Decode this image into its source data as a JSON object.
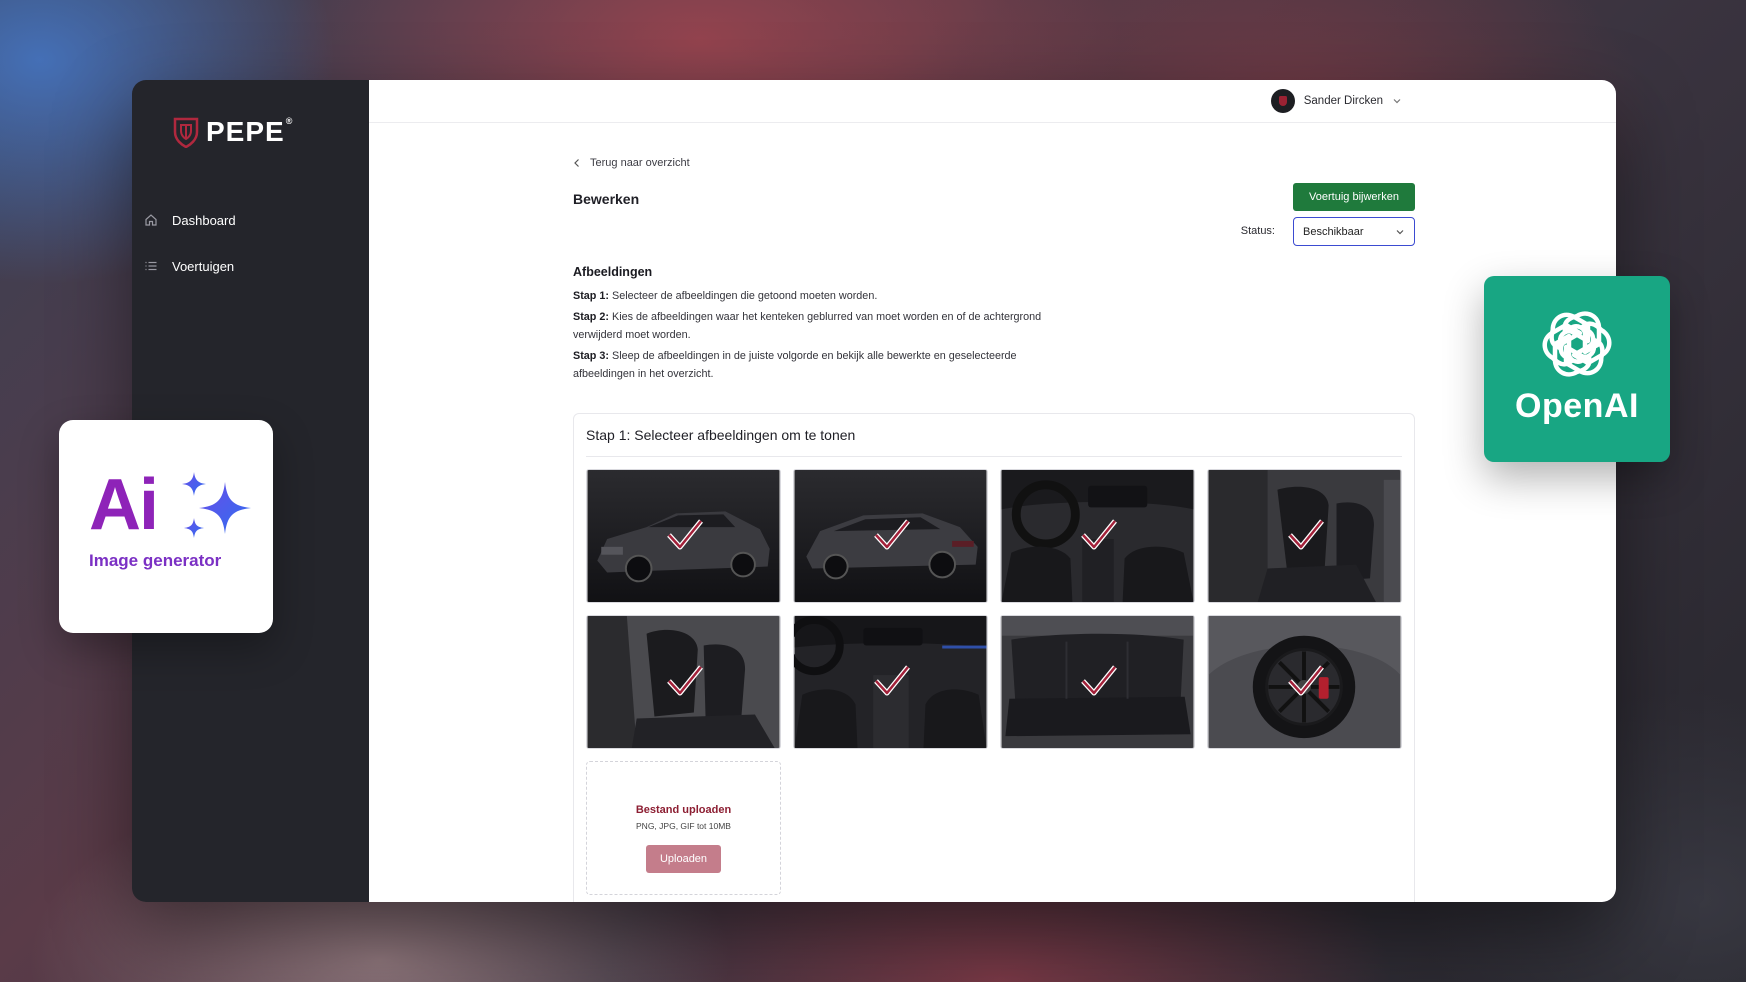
{
  "brand": {
    "name": "PEPE",
    "registered": "®",
    "accent": "#b0283e"
  },
  "sidebar": {
    "items": [
      {
        "label": "Dashboard",
        "icon": "home-icon"
      },
      {
        "label": "Voertuigen",
        "icon": "list-icon"
      }
    ]
  },
  "topbar": {
    "user_name": "Sander Dircken"
  },
  "page": {
    "back_label": "Terug naar overzicht",
    "title": "Bewerken",
    "update_button": "Voertuig bijwerken",
    "status_label": "Status:",
    "status_value": "Beschikbaar"
  },
  "images_section": {
    "title": "Afbeeldingen",
    "steps": [
      {
        "label": "Stap 1:",
        "text": "Selecteer de afbeeldingen die getoond moeten worden."
      },
      {
        "label": "Stap 2:",
        "text": "Kies de afbeeldingen waar het kenteken geblurred van moet worden en of de achtergrond verwijderd moet worden."
      },
      {
        "label": "Stap 3:",
        "text": "Sleep de afbeeldingen in de juiste volgorde en bekijk alle bewerkte en geselecteerde afbeeldingen in het overzicht."
      }
    ]
  },
  "step1_card": {
    "title": "Stap 1: Selecteer afbeeldingen om te tonen",
    "photos": [
      {
        "subject": "car-front-three-quarter",
        "selected": true
      },
      {
        "subject": "car-rear-three-quarter",
        "selected": true
      },
      {
        "subject": "dashboard-interior",
        "selected": true
      },
      {
        "subject": "front-seats-side",
        "selected": true
      },
      {
        "subject": "front-seats-door-open",
        "selected": true
      },
      {
        "subject": "center-console",
        "selected": true
      },
      {
        "subject": "rear-seats",
        "selected": true
      },
      {
        "subject": "wheel-closeup",
        "selected": true
      }
    ],
    "upload": {
      "title": "Bestand uploaden",
      "hint": "PNG, JPG, GIF tot 10MB",
      "button": "Uploaden"
    }
  },
  "badges": {
    "ai_text": "Ai",
    "ai_subtitle": "Image generator",
    "openai_text": "OpenAI"
  },
  "colors": {
    "sidebar_bg": "#24252b",
    "primary_green": "#1f7a3c",
    "select_border": "#3b4bd1",
    "upload_title": "#8d1f33",
    "openai_green": "#18a683",
    "ai_purple": "#8e23b8"
  }
}
